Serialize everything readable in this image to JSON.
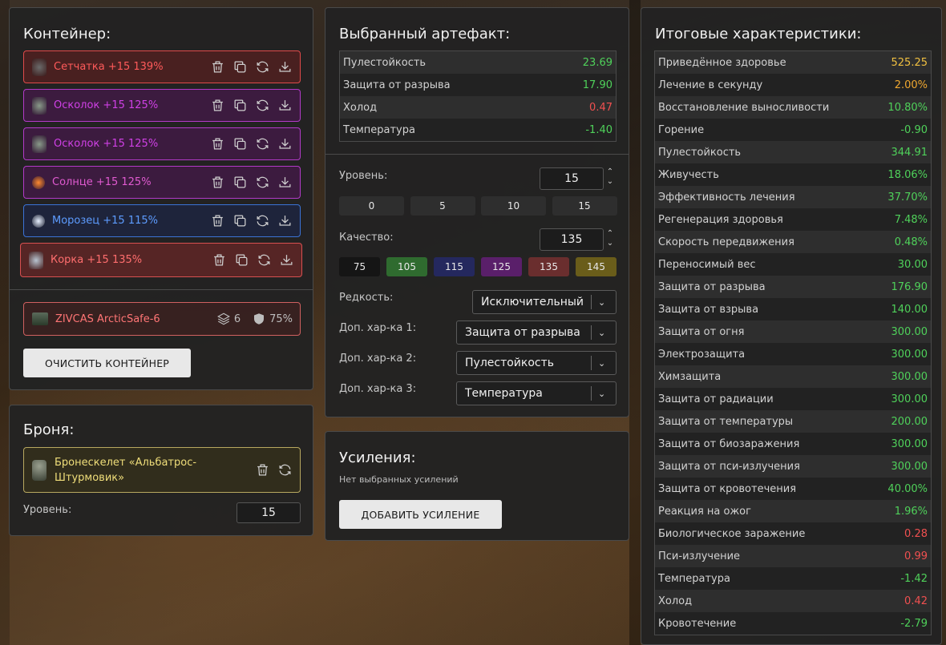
{
  "container": {
    "title": "Контейнер:",
    "artifacts": [
      {
        "name": "Сетчатка +15 139%",
        "style": "r-red",
        "icon_color": "#6b6b6b"
      },
      {
        "name": "Осколок +15 125%",
        "style": "r-purple",
        "icon_color": "#8a9a8a"
      },
      {
        "name": "Осколок +15 125%",
        "style": "r-purple",
        "icon_color": "#8a9a8a"
      },
      {
        "name": "Солнце +15 125%",
        "style": "r-orange",
        "icon_color": "#ff8a30"
      },
      {
        "name": "Морозец +15 115%",
        "style": "r-blue",
        "icon_color": "#e8f0ff"
      },
      {
        "name": "Корка +15 135%",
        "style": "r-redlight",
        "icon_color": "#b8c4d0"
      }
    ],
    "suit": {
      "name": "ZIVCAS ArcticSafe-6",
      "slots": "6",
      "protection": "75%"
    },
    "clear_button": "ОЧИСТИТЬ КОНТЕЙНЕР"
  },
  "armor": {
    "title": "Броня:",
    "name": "Бронескелет «Альбатрос-Штурмовик»",
    "level_label": "Уровень:",
    "level": "15"
  },
  "artifact": {
    "title": "Выбранный артефакт:",
    "stats": [
      {
        "label": "Пулестойкость",
        "value": "23.69",
        "tone": "v-green"
      },
      {
        "label": "Защита от разрыва",
        "value": "17.90",
        "tone": "v-green"
      },
      {
        "label": "Холод",
        "value": "0.47",
        "tone": "v-red"
      },
      {
        "label": "Температура",
        "value": "-1.40",
        "tone": "v-green"
      }
    ],
    "level_label": "Уровень:",
    "level": "15",
    "level_presets": [
      "0",
      "5",
      "10",
      "15"
    ],
    "quality_label": "Качество:",
    "quality": "135",
    "quality_presets": [
      {
        "label": "75",
        "color": "#151515"
      },
      {
        "label": "105",
        "color": "#2f6b2f"
      },
      {
        "label": "115",
        "color": "#24285e"
      },
      {
        "label": "125",
        "color": "#5a1f6a"
      },
      {
        "label": "135",
        "color": "#6a2e2e"
      },
      {
        "label": "145",
        "color": "#6a5d1a"
      }
    ],
    "rarity_label": "Редкость:",
    "rarity": "Исключительный",
    "extra1_label": "Доп. хар-ка 1:",
    "extra1": "Защита от разрыва",
    "extra2_label": "Доп. хар-ка 2:",
    "extra2": "Пулестойкость",
    "extra3_label": "Доп. хар-ка 3:",
    "extra3": "Температура"
  },
  "boost": {
    "title": "Усиления:",
    "empty_text": "Нет выбранных усилений",
    "add_button": "ДОБАВИТЬ УСИЛЕНИЕ"
  },
  "totals": {
    "title": "Итоговые характеристики:",
    "stats": [
      {
        "label": "Приведённое здоровье",
        "value": "525.25",
        "tone": "v-gold"
      },
      {
        "label": "Лечение в секунду",
        "value": "2.00%",
        "tone": "v-orange"
      },
      {
        "label": "Восстановление выносливости",
        "value": "10.80%",
        "tone": "v-green"
      },
      {
        "label": "Горение",
        "value": "-0.90",
        "tone": "v-green"
      },
      {
        "label": "Пулестойкость",
        "value": "344.91",
        "tone": "v-green"
      },
      {
        "label": "Живучесть",
        "value": "18.06%",
        "tone": "v-green"
      },
      {
        "label": "Эффективность лечения",
        "value": "37.70%",
        "tone": "v-green"
      },
      {
        "label": "Регенерация здоровья",
        "value": "7.48%",
        "tone": "v-green"
      },
      {
        "label": "Скорость передвижения",
        "value": "0.48%",
        "tone": "v-green"
      },
      {
        "label": "Переносимый вес",
        "value": "30.00",
        "tone": "v-green"
      },
      {
        "label": "Защита от разрыва",
        "value": "176.90",
        "tone": "v-green"
      },
      {
        "label": "Защита от взрыва",
        "value": "140.00",
        "tone": "v-green"
      },
      {
        "label": "Защита от огня",
        "value": "300.00",
        "tone": "v-green"
      },
      {
        "label": "Электрозащита",
        "value": "300.00",
        "tone": "v-green"
      },
      {
        "label": "Химзащита",
        "value": "300.00",
        "tone": "v-green"
      },
      {
        "label": "Защита от радиации",
        "value": "300.00",
        "tone": "v-green"
      },
      {
        "label": "Защита от температуры",
        "value": "200.00",
        "tone": "v-green"
      },
      {
        "label": "Защита от биозаражения",
        "value": "300.00",
        "tone": "v-green"
      },
      {
        "label": "Защита от пси-излучения",
        "value": "300.00",
        "tone": "v-green"
      },
      {
        "label": "Защита от кровотечения",
        "value": "40.00%",
        "tone": "v-green"
      },
      {
        "label": "Реакция на ожог",
        "value": "1.96%",
        "tone": "v-green"
      },
      {
        "label": "Биологическое заражение",
        "value": "0.28",
        "tone": "v-red"
      },
      {
        "label": "Пси-излучение",
        "value": "0.99",
        "tone": "v-red"
      },
      {
        "label": "Температура",
        "value": "-1.42",
        "tone": "v-green"
      },
      {
        "label": "Холод",
        "value": "0.42",
        "tone": "v-red"
      },
      {
        "label": "Кровотечение",
        "value": "-2.79",
        "tone": "v-green"
      }
    ]
  }
}
